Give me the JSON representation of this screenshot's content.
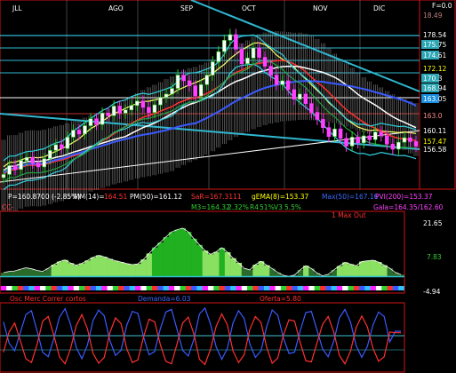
{
  "app": {
    "f_value": "F=0.0"
  },
  "months": [
    "JLL",
    "AGO",
    "SEP",
    "OCT",
    "NOV",
    "DIC"
  ],
  "price_scale": [
    {
      "value": "18.49",
      "color": "#c08080",
      "bg": "none"
    },
    {
      "value": "178.54",
      "color": "#ffffff",
      "bg": "none"
    },
    {
      "value": "175.75",
      "color": "#ffffff",
      "bg": "#2aa6b4"
    },
    {
      "value": "174.61",
      "color": "#ffffff",
      "bg": "#2aa6b4"
    },
    {
      "value": "172.12",
      "color": "#ffff00",
      "bg": "none"
    },
    {
      "value": "170.3",
      "color": "#ffffff",
      "bg": "#2aa6b4"
    },
    {
      "value": "168.94",
      "color": "#ffffff",
      "bg": "#2aa6b4"
    },
    {
      "value": "163.05",
      "color": "#ffffff",
      "bg": "#1a8fe0"
    },
    {
      "value": "163.0",
      "color": "#ff8888",
      "bg": "none"
    },
    {
      "value": "160.11",
      "color": "#ffffff",
      "bg": "none"
    },
    {
      "value": "157.47",
      "color": "#ffff00",
      "bg": "none"
    },
    {
      "value": "156.58",
      "color": "#ffffff",
      "bg": "none"
    }
  ],
  "legend": {
    "p": "P=160.8700 (-2.85%)",
    "mm14": "MM(14)=",
    "mm14_val": "164.51",
    "pm50": "PM(50)=161.12",
    "sar": "SaR=167.3111",
    "gema": "gEMA(8)=153.37",
    "msg": "Max(50)=167.16",
    "pvi": "PVI(200)=153.37",
    "cc": "CC-",
    "m3": "M3=164.32",
    "m3b": "2.32%",
    "r4": "R4",
    "r4b": "51%",
    "v3": "V3",
    "v3b": "5.5%",
    "gala": "Gala=164.35/162.60",
    "max_out": "1 Max Out"
  },
  "macd_scale": [
    "21.65",
    "7.83",
    "-4.94"
  ],
  "osc_legend": {
    "title": "Osc Merc Correr cortos",
    "demanda": "Demanda=6.03",
    "oferta": "Oferta=5.80"
  },
  "chart_data": {
    "type": "candlestick",
    "months": [
      "JLL",
      "AGO",
      "SEP",
      "OCT",
      "NOV",
      "DIC"
    ],
    "price_ylim": [
      154.5,
      182
    ],
    "close": [
      156.4,
      157.8,
      157.2,
      158.6,
      159.1,
      158.2,
      157.6,
      158.9,
      160.2,
      161.1,
      160.5,
      162.3,
      163.4,
      162.8,
      164.1,
      165.2,
      164.3,
      166.1,
      165.7,
      167.2,
      166.1,
      166.6,
      167.3,
      168.0,
      167.0,
      166.2,
      167.4,
      168.6,
      169.1,
      170.0,
      172.1,
      171.2,
      170.4,
      168.8,
      170.6,
      172.1,
      174.2,
      175.8,
      177.6,
      178.5,
      176.2,
      173.9,
      174.8,
      176.4,
      174.9,
      173.5,
      172.1,
      170.6,
      171.2,
      169.8,
      168.3,
      169.1,
      167.6,
      166.2,
      165.1,
      163.8,
      162.4,
      163.6,
      162.1,
      160.9,
      162.3,
      161.4,
      162.5,
      161.9,
      163.1,
      162.5,
      161.2,
      160.4,
      161.5,
      162.2,
      161.6,
      160.87
    ],
    "macd_ylim": [
      -4.94,
      21.65
    ],
    "macd": [
      1.5,
      2.0,
      2.2,
      2.8,
      3.4,
      3.0,
      2.4,
      2.0,
      3.2,
      4.6,
      5.8,
      6.4,
      5.2,
      4.4,
      5.1,
      6.2,
      7.4,
      8.2,
      7.6,
      6.8,
      6.1,
      5.6,
      5.0,
      4.6,
      4.9,
      6.6,
      8.9,
      11.2,
      13.1,
      15.2,
      17.1,
      18.0,
      18.6,
      17.2,
      14.6,
      12.2,
      10.0,
      8.6,
      9.5,
      11.1,
      9.4,
      7.1,
      5.3,
      3.2,
      2.6,
      4.6,
      5.9,
      4.4,
      3.1,
      1.6,
      0.5,
      0.1,
      0.6,
      2.6,
      4.2,
      3.1,
      1.4,
      0.3,
      0.9,
      2.6,
      4.1,
      5.5,
      4.8,
      4.2,
      5.8,
      6.1,
      6.3,
      5.6,
      4.4,
      3.2,
      1.6,
      0.8
    ],
    "demanda": [
      7.5,
      4.2,
      3.0,
      5.8,
      8.6,
      9.2,
      6.1,
      2.8,
      2.1,
      4.9,
      8.2,
      9.5,
      7.0,
      3.5,
      1.8,
      3.9,
      7.7,
      9.3,
      8.4,
      4.6,
      2.3,
      3.1,
      6.9,
      9.1,
      8.8,
      5.2,
      2.4,
      2.9,
      6.4,
      9.0,
      9.4,
      6.3,
      3.1,
      2.2,
      4.8,
      8.7,
      9.6,
      7.1,
      3.6,
      1.7,
      3.4,
      7.3,
      9.2,
      8.0,
      4.1,
      2.0,
      3.0,
      6.7,
      9.3,
      8.5,
      5.0,
      2.6,
      2.8,
      6.1,
      8.9,
      9.1,
      6.2,
      3.3,
      2.1,
      4.5,
      8.1,
      9.4,
      7.4,
      3.8,
      2.0,
      3.7,
      7.0,
      9.0,
      8.3,
      4.4,
      6.03,
      6.03
    ],
    "oferta": [
      2.8,
      5.9,
      7.3,
      4.6,
      1.8,
      1.2,
      4.0,
      7.6,
      8.3,
      5.4,
      2.1,
      1.0,
      3.4,
      6.9,
      8.6,
      6.4,
      2.6,
      1.1,
      2.0,
      5.8,
      8.1,
      7.2,
      3.4,
      1.2,
      1.6,
      5.1,
      7.9,
      7.5,
      4.0,
      1.4,
      1.0,
      4.1,
      7.3,
      8.2,
      5.6,
      1.7,
      0.9,
      3.3,
      6.8,
      8.7,
      7.0,
      3.0,
      1.2,
      2.4,
      6.3,
      8.3,
      7.4,
      3.6,
      1.1,
      1.9,
      5.4,
      7.8,
      7.6,
      4.3,
      1.5,
      1.3,
      4.2,
      7.1,
      8.3,
      5.9,
      2.3,
      1.0,
      3.0,
      6.6,
      8.4,
      6.7,
      3.4,
      1.4,
      2.1,
      5.9,
      5.8,
      5.8
    ]
  }
}
